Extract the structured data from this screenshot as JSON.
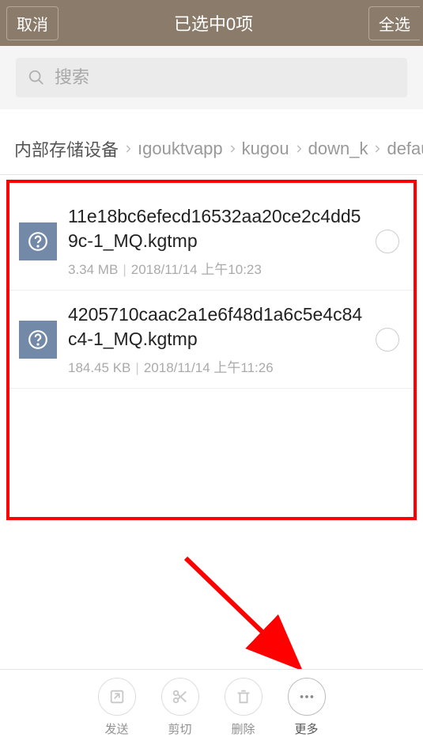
{
  "topbar": {
    "cancel": "取消",
    "title": "已选中0项",
    "select_all": "全选"
  },
  "search": {
    "placeholder": "搜索"
  },
  "breadcrumb": {
    "items": [
      "内部存储设备",
      "ıgouktvapp",
      "kugou",
      "down_k",
      "defau"
    ]
  },
  "files": [
    {
      "name": "11e18bc6efecd16532aa20ce2c4dd59c-1_MQ.kgtmp",
      "size": "3.34 MB",
      "date": "2018/11/14 上午10:23"
    },
    {
      "name": "4205710caac2a1e6f48d1a6c5e4c84c4-1_MQ.kgtmp",
      "size": "184.45 KB",
      "date": "2018/11/14 上午11:26"
    }
  ],
  "toolbar": {
    "send": "发送",
    "cut": "剪切",
    "delete": "删除",
    "more": "更多"
  }
}
